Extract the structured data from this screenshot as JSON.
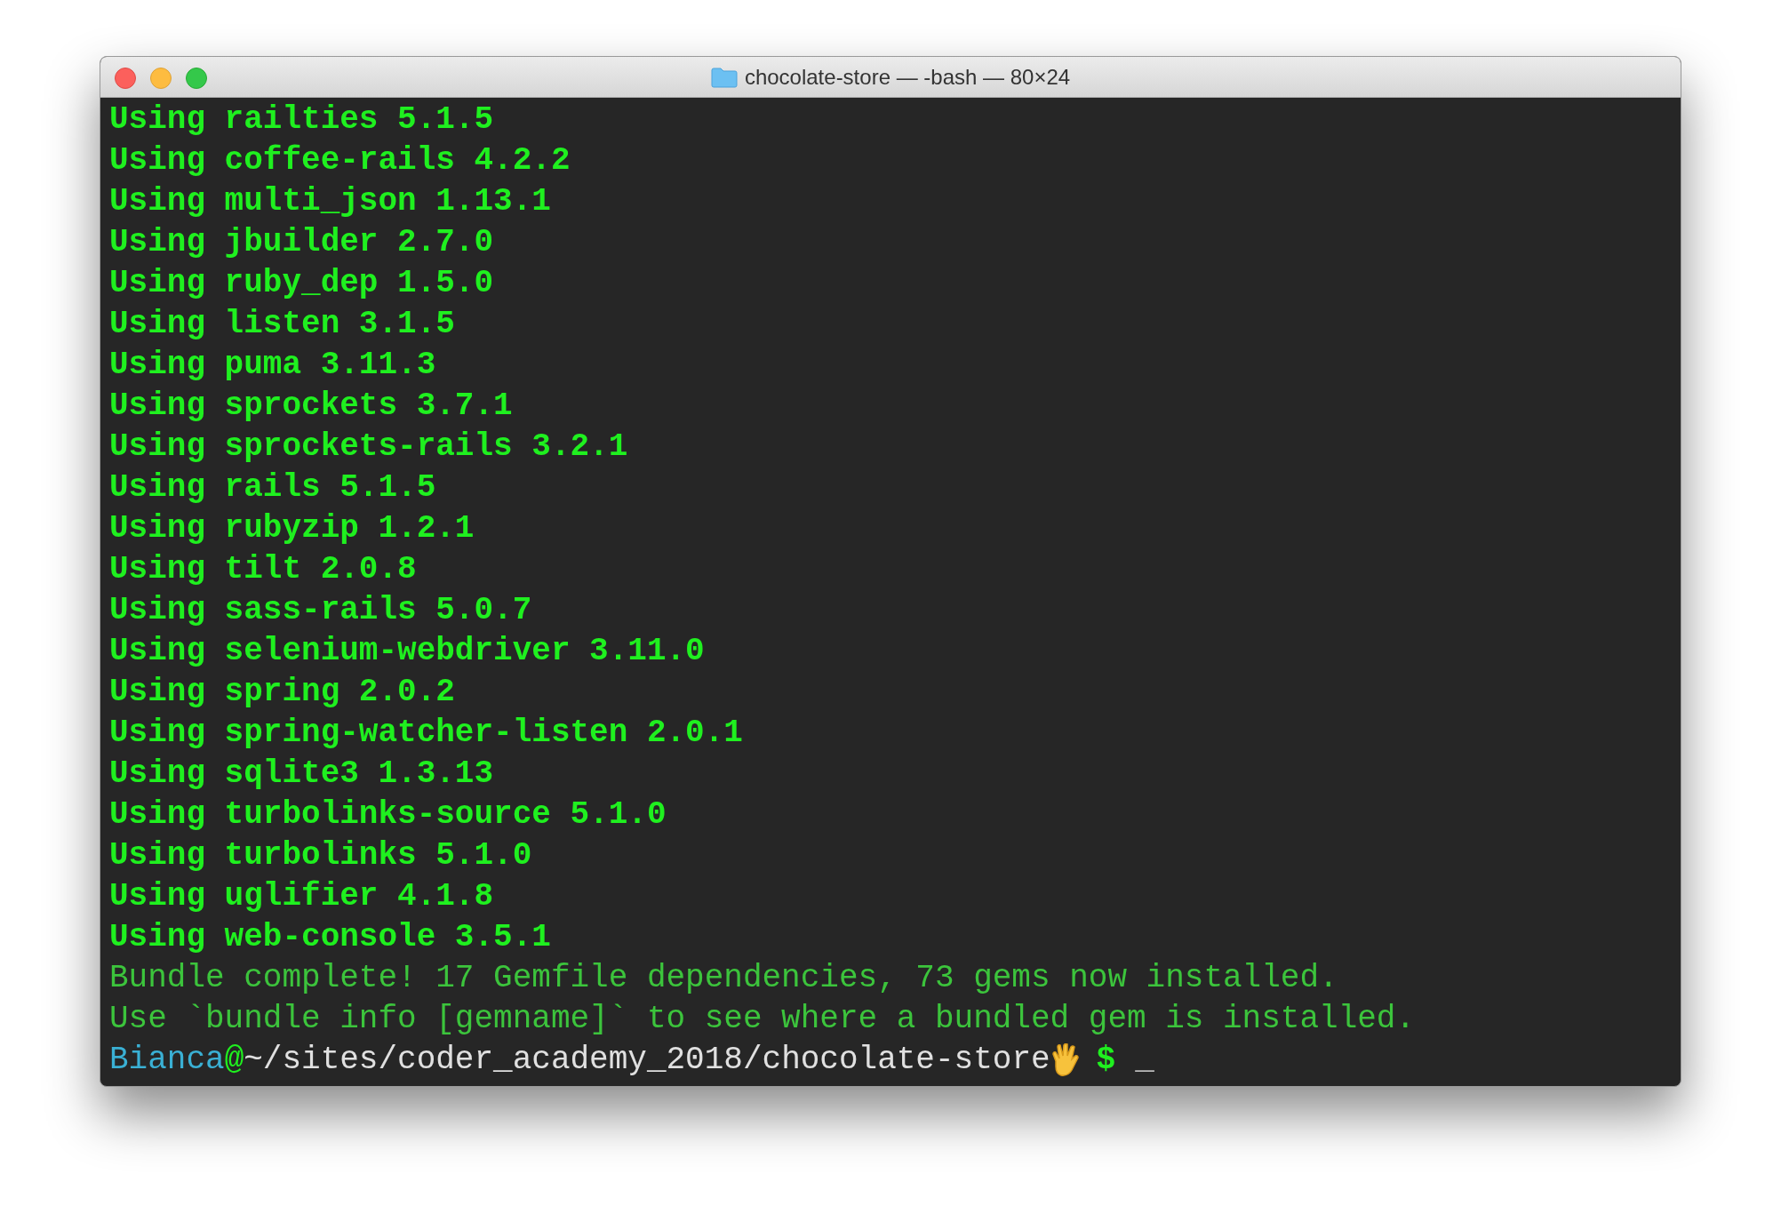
{
  "window": {
    "title": "chocolate-store — -bash — 80×24"
  },
  "lines": [
    {
      "kind": "installed",
      "text": "Using railties 5.1.5"
    },
    {
      "kind": "installed",
      "text": "Using coffee-rails 4.2.2"
    },
    {
      "kind": "installed",
      "text": "Using multi_json 1.13.1"
    },
    {
      "kind": "installed",
      "text": "Using jbuilder 2.7.0"
    },
    {
      "kind": "installed",
      "text": "Using ruby_dep 1.5.0"
    },
    {
      "kind": "installed",
      "text": "Using listen 3.1.5"
    },
    {
      "kind": "installed",
      "text": "Using puma 3.11.3"
    },
    {
      "kind": "installed",
      "text": "Using sprockets 3.7.1"
    },
    {
      "kind": "installed",
      "text": "Using sprockets-rails 3.2.1"
    },
    {
      "kind": "installed",
      "text": "Using rails 5.1.5"
    },
    {
      "kind": "installed",
      "text": "Using rubyzip 1.2.1"
    },
    {
      "kind": "installed",
      "text": "Using tilt 2.0.8"
    },
    {
      "kind": "installed",
      "text": "Using sass-rails 5.0.7"
    },
    {
      "kind": "installed",
      "text": "Using selenium-webdriver 3.11.0"
    },
    {
      "kind": "installed",
      "text": "Using spring 2.0.2"
    },
    {
      "kind": "installed",
      "text": "Using spring-watcher-listen 2.0.1"
    },
    {
      "kind": "installed",
      "text": "Using sqlite3 1.3.13"
    },
    {
      "kind": "installed",
      "text": "Using turbolinks-source 5.1.0"
    },
    {
      "kind": "installed",
      "text": "Using turbolinks 5.1.0"
    },
    {
      "kind": "installed",
      "text": "Using uglifier 4.1.8"
    },
    {
      "kind": "installed",
      "text": "Using web-console 3.5.1"
    },
    {
      "kind": "info",
      "text": "Bundle complete! 17 Gemfile dependencies, 73 gems now installed."
    },
    {
      "kind": "info",
      "text": "Use `bundle info [gemname]` to see where a bundled gem is installed."
    }
  ],
  "prompt": {
    "user": "Bianca",
    "at": "@",
    "path": "~/sites/coder_academy_2018/chocolate-store",
    "symbol": "$",
    "cursor": "_"
  }
}
